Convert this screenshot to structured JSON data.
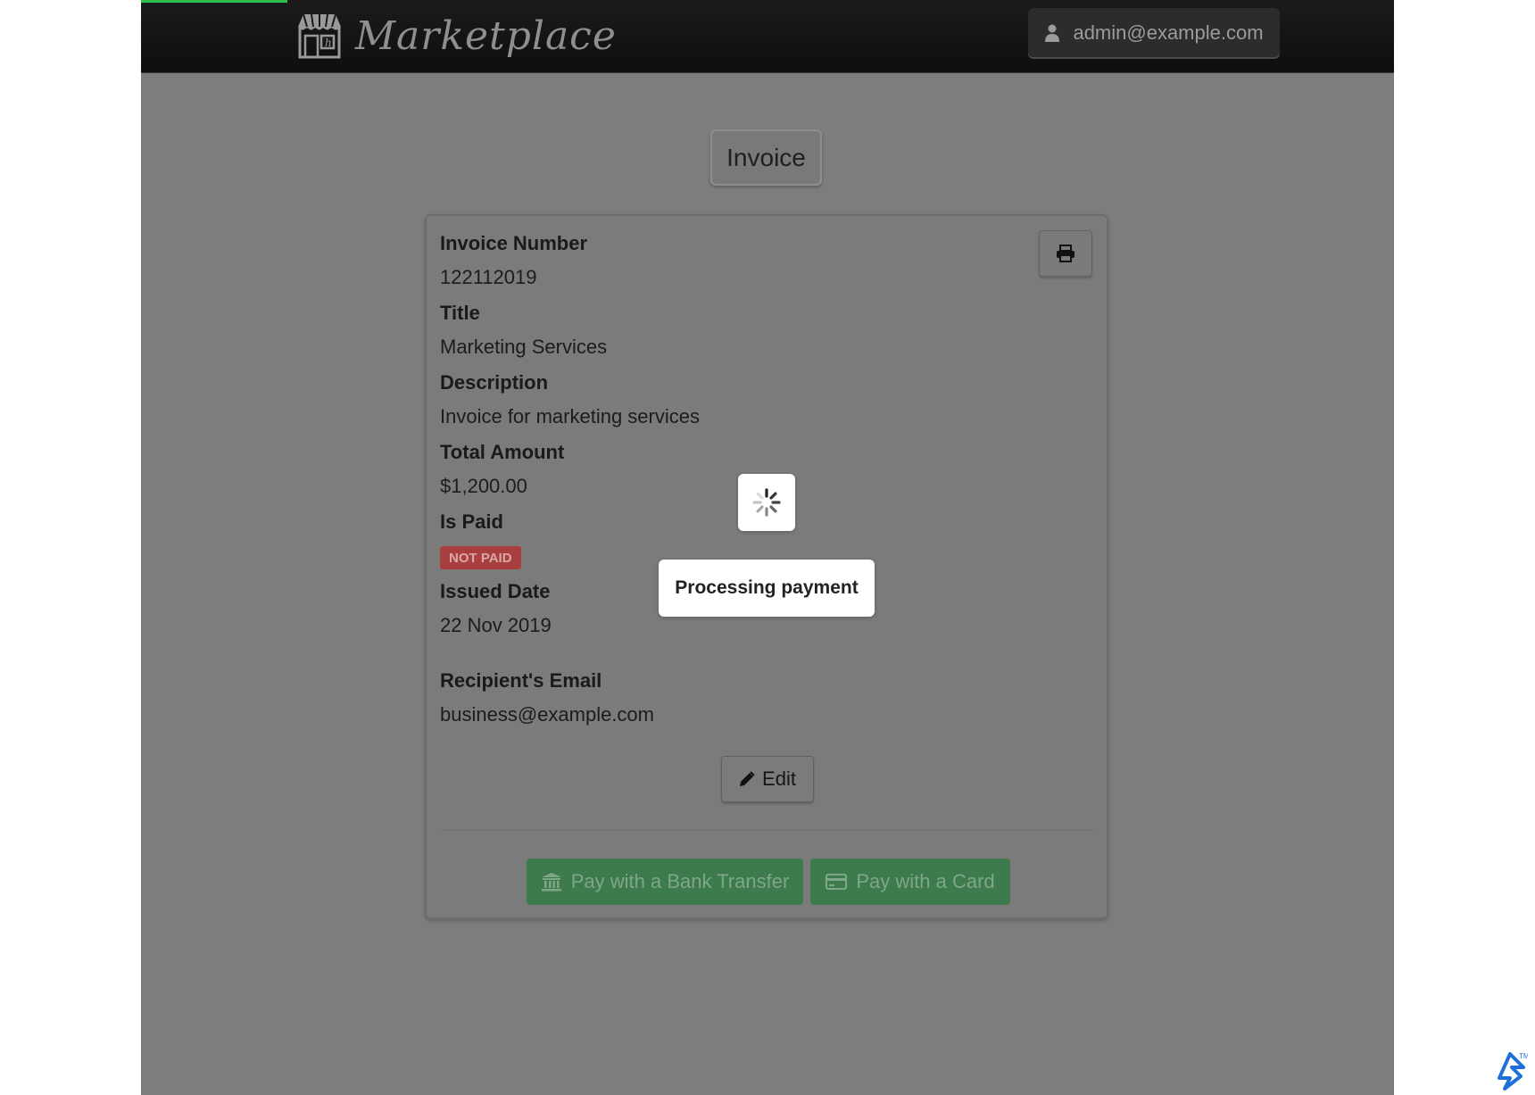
{
  "header": {
    "brand_name": "Marketplace",
    "brand_icon": "storefront-icon",
    "user_email": "admin@example.com",
    "user_icon": "user-icon"
  },
  "page": {
    "title": "Invoice"
  },
  "invoice": {
    "fields": [
      {
        "label": "Invoice Number",
        "value": "122112019"
      },
      {
        "label": "Title",
        "value": "Marketing Services"
      },
      {
        "label": "Description",
        "value": "Invoice for marketing services"
      },
      {
        "label": "Total Amount",
        "value": "$1,200.00"
      },
      {
        "label": "Is Paid",
        "badge": "NOT PAID"
      },
      {
        "label": "Issued Date",
        "value": "22 Nov 2019"
      },
      {
        "label": "Recipient's Email",
        "value": "business@example.com"
      }
    ],
    "print_icon": "printer-icon",
    "edit_label": "Edit",
    "edit_icon": "pencil-icon",
    "pay_bank_label": "Pay with a Bank Transfer",
    "pay_bank_icon": "bank-icon",
    "pay_card_label": "Pay with a Card",
    "pay_card_icon": "credit-card-icon"
  },
  "overlay": {
    "spinner_icon": "spinner-icon",
    "message": "Processing payment"
  },
  "colors": {
    "navbar": "#111111",
    "overlay_background": "#7c7d7c",
    "badge_not_paid": "#a93e3e",
    "pay_button": "#3d7a4c",
    "progress": "#2fbf4f",
    "watermark": "#1f6fd8"
  }
}
